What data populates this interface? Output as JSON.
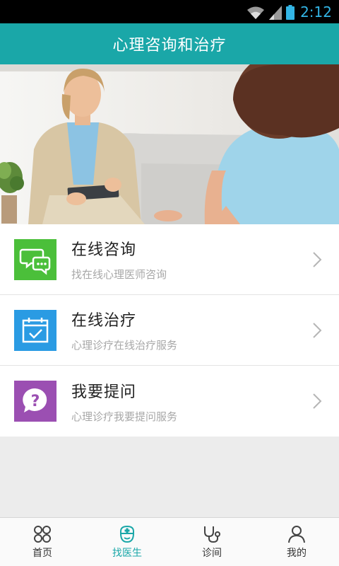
{
  "status_bar": {
    "time": "2:12"
  },
  "header": {
    "title": "心理咨询和治疗"
  },
  "menu": [
    {
      "label": "在线咨询",
      "subtitle": "找在线心理医师咨询",
      "icon": "chat-bubbles-icon",
      "color": "#4bbf3a"
    },
    {
      "label": "在线治疗",
      "subtitle": "心理诊疗在线治疗服务",
      "icon": "calendar-check-icon",
      "color": "#2a9be3"
    },
    {
      "label": "我要提问",
      "subtitle": "心理诊疗我要提问服务",
      "icon": "question-bubble-icon",
      "color": "#9b4fb2"
    }
  ],
  "tabs": [
    {
      "label": "首页",
      "icon": "home-grid-icon",
      "active": false
    },
    {
      "label": "找医生",
      "icon": "nurse-icon",
      "active": true
    },
    {
      "label": "诊间",
      "icon": "stethoscope-icon",
      "active": false
    },
    {
      "label": "我的",
      "icon": "user-icon",
      "active": false
    }
  ],
  "colors": {
    "accent": "#1aa7a8",
    "status_time": "#33b5e5"
  }
}
